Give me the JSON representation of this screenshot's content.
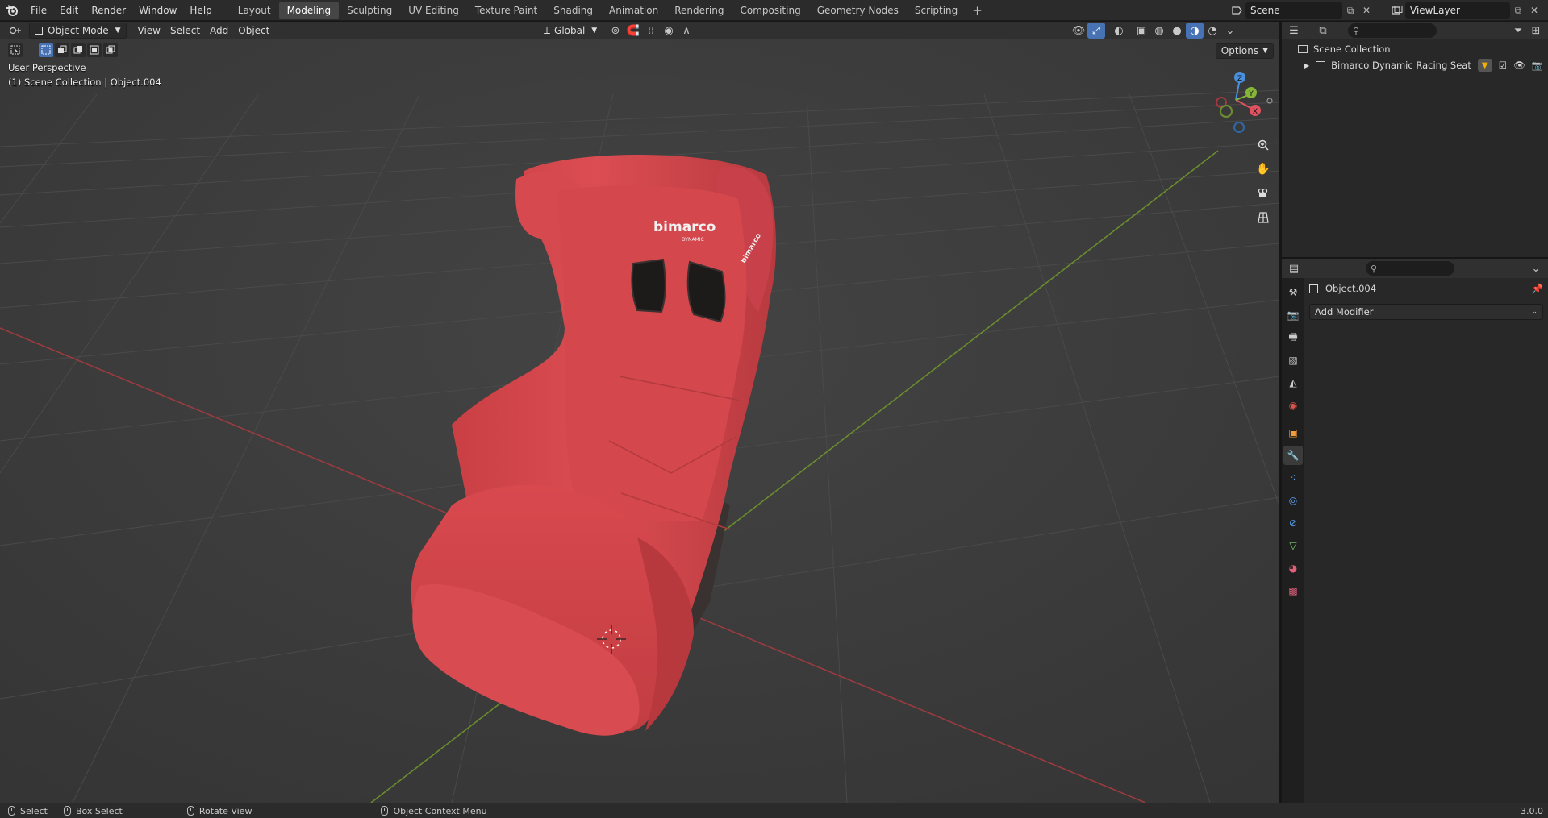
{
  "topbar": {
    "menus": [
      "File",
      "Edit",
      "Render",
      "Window",
      "Help"
    ],
    "workspaces": [
      "Layout",
      "Modeling",
      "Sculpting",
      "UV Editing",
      "Texture Paint",
      "Shading",
      "Animation",
      "Rendering",
      "Compositing",
      "Geometry Nodes",
      "Scripting"
    ],
    "active_workspace": "Modeling",
    "add_tab": "+",
    "scene": "Scene",
    "view_layer": "ViewLayer"
  },
  "viewport": {
    "mode": "Object Mode",
    "menus": [
      "View",
      "Select",
      "Add",
      "Object"
    ],
    "orientation": "Global",
    "options_label": "Options",
    "info_line1": "User Perspective",
    "info_line2": "(1) Scene Collection | Object.004",
    "gizmo": {
      "x": "X",
      "y": "Y",
      "z": "Z"
    },
    "seat_logo": "bimarco",
    "seat_logo_sub": "DYNAMIC"
  },
  "outliner": {
    "root": "Scene Collection",
    "items": [
      {
        "label": "Bimarco Dynamic Racing Seat"
      }
    ]
  },
  "properties": {
    "object_name": "Object.004",
    "add_modifier": "Add Modifier"
  },
  "statusbar": {
    "select": "Select",
    "box_select": "Box Select",
    "rotate_view": "Rotate View",
    "context_menu": "Object Context Menu",
    "version": "3.0.0"
  },
  "colors": {
    "accent": "#4772b3",
    "x_axis": "#e0525f",
    "y_axis": "#86b53a",
    "z_axis": "#4a8fdc",
    "seat": "#d94a4e"
  }
}
